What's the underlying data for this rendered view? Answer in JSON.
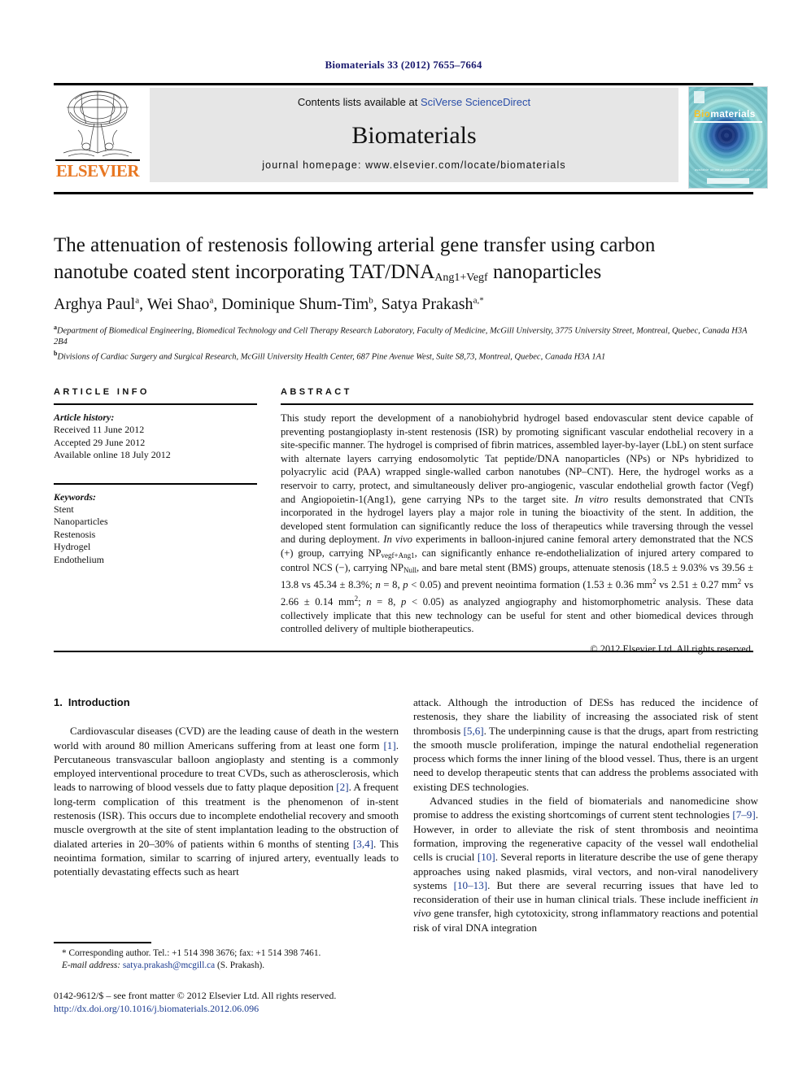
{
  "running_head": "Biomaterials 33 (2012) 7655–7664",
  "header": {
    "contents_prefix": "Contents lists available at ",
    "contents_link": "SciVerse ScienceDirect",
    "journal_name": "Biomaterials",
    "homepage": "journal homepage: www.elsevier.com/locate/biomaterials",
    "publisher": "ELSEVIER",
    "cover": {
      "title_a": "Bio",
      "title_b": "materials",
      "footer_text": "available online at www.sciencedirect.com"
    }
  },
  "article": {
    "title_line1": "The attenuation of restenosis following arterial gene transfer using carbon",
    "title_line2_pre": "nanotube coated stent incorporating TAT/DNA",
    "title_sub": "Ang1+Vegf",
    "title_line2_post": " nanoparticles",
    "authors": "Arghya Paul a, Wei Shao a, Dominique Shum-Tim b, Satya Prakash a,*",
    "affiliation_a": "Department of Biomedical Engineering, Biomedical Technology and Cell Therapy Research Laboratory, Faculty of Medicine, McGill University, 3775 University Street, Montreal, Quebec, Canada H3A 2B4",
    "affiliation_b": "Divisions of Cardiac Surgery and Surgical Research, McGill University Health Center, 687 Pine Avenue West, Suite S8,73, Montreal, Quebec, Canada H3A 1A1"
  },
  "article_info": {
    "heading": "ARTICLE INFO",
    "history_label": "Article history:",
    "history": [
      "Received 11 June 2012",
      "Accepted 29 June 2012",
      "Available online 18 July 2012"
    ],
    "keywords_label": "Keywords:",
    "keywords": [
      "Stent",
      "Nanoparticles",
      "Restenosis",
      "Hydrogel",
      "Endothelium"
    ]
  },
  "abstract": {
    "heading": "ABSTRACT",
    "text": "This study report the development of a nanobiohybrid hydrogel based endovascular stent device capable of preventing postangioplasty in-stent restenosis (ISR) by promoting significant vascular endothelial recovery in a site-specific manner. The hydrogel is comprised of fibrin matrices, assembled layer-by-layer (LbL) on stent surface with alternate layers carrying endosomolytic Tat peptide/DNA nanoparticles (NPs) or NPs hybridized to polyacrylic acid (PAA) wrapped single-walled carbon nanotubes (NP–CNT). Here, the hydrogel works as a reservoir to carry, protect, and simultaneously deliver pro-angiogenic, vascular endothelial growth factor (Vegf) and Angiopoietin-1(Ang1), gene carrying NPs to the target site. In vitro results demonstrated that CNTs incorporated in the hydrogel layers play a major role in tuning the bioactivity of the stent. In addition, the developed stent formulation can significantly reduce the loss of therapeutics while traversing through the vessel and during deployment. In vivo experiments in balloon-injured canine femoral artery demonstrated that the NCS (+) group, carrying NPvegf+Ang1, can significantly enhance re-endothelialization of injured artery compared to control NCS (−), carrying NPNull, and bare metal stent (BMS) groups, attenuate stenosis (18.5 ± 9.03% vs 39.56 ± 13.8 vs 45.34 ± 8.3%; n = 8, p < 0.05) and prevent neointima formation (1.53 ± 0.36 mm2 vs 2.51 ± 0.27 mm2 vs 2.66 ± 0.14 mm2; n = 8, p < 0.05) as analyzed angiography and histomorphometric analysis. These data collectively implicate that this new technology can be useful for stent and other biomedical devices through controlled delivery of multiple biotherapeutics.",
    "copyright": "© 2012 Elsevier Ltd. All rights reserved."
  },
  "body": {
    "section_number": "1.",
    "section_title": "Introduction",
    "left_paragraphs": [
      "Cardiovascular diseases (CVD) are the leading cause of death in the western world with around 80 million Americans suffering from at least one form [1]. Percutaneous transvascular balloon angioplasty and stenting is a commonly employed interventional procedure to treat CVDs, such as atherosclerosis, which leads to narrowing of blood vessels due to fatty plaque deposition [2]. A frequent long-term complication of this treatment is the phenomenon of in-stent restenosis (ISR). This occurs due to incomplete endothelial recovery and smooth muscle overgrowth at the site of stent implantation leading to the obstruction of dialated arteries in 20–30% of patients within 6 months of stenting [3,4]. This neointima formation, similar to scarring of injured artery, eventually leads to potentially devastating effects such as heart"
    ],
    "right_paragraphs": [
      "attack. Although the introduction of DESs has reduced the incidence of restenosis, they share the liability of increasing the associated risk of stent thrombosis [5,6]. The underpinning cause is that the drugs, apart from restricting the smooth muscle proliferation, impinge the natural endothelial regeneration process which forms the inner lining of the blood vessel. Thus, there is an urgent need to develop therapeutic stents that can address the problems associated with existing DES technologies.",
      "Advanced studies in the field of biomaterials and nanomedicine show promise to address the existing shortcomings of current stent technologies [7–9]. However, in order to alleviate the risk of stent thrombosis and neointima formation, improving the regenerative capacity of the vessel wall endothelial cells is crucial [10]. Several reports in literature describe the use of gene therapy approaches using naked plasmids, viral vectors, and non-viral nanodelivery systems [10–13]. But there are several recurring issues that have led to reconsideration of their use in human clinical trials. These include inefficient in vivo gene transfer, high cytotoxicity, strong inflammatory reactions and potential risk of viral DNA integration"
    ]
  },
  "footnotes": {
    "corresponding": "* Corresponding author. Tel.: +1 514 398 3676; fax: +1 514 398 7461.",
    "email_label": "E-mail address:",
    "email": "satya.prakash@mcgill.ca",
    "email_suffix": "(S. Prakash)."
  },
  "imprint": {
    "line1": "0142-9612/$ – see front matter © 2012 Elsevier Ltd. All rights reserved.",
    "doi": "http://dx.doi.org/10.1016/j.biomaterials.2012.06.096"
  },
  "colors": {
    "running_head": "#1a1a6e",
    "link": "#2a4ea8",
    "reference": "#1a3a8f",
    "elsevier_orange": "#e87722",
    "band_bg": "#e6e6e6"
  }
}
